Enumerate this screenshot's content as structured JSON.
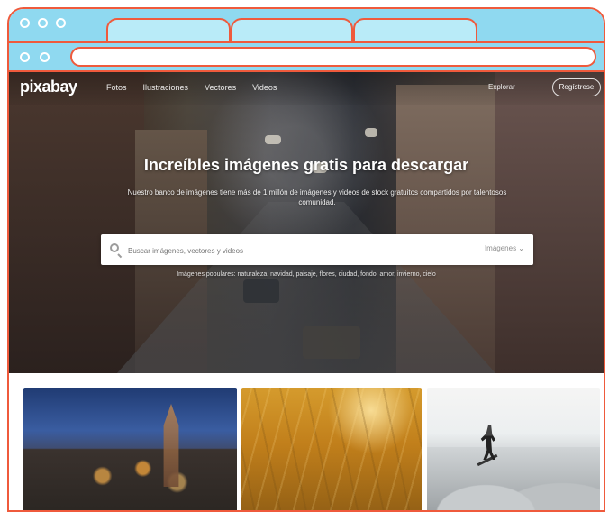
{
  "browser": {
    "address_value": "",
    "tabs": [
      {
        "label": ""
      },
      {
        "label": ""
      },
      {
        "label": ""
      }
    ]
  },
  "site": {
    "logo": "pixabay",
    "menu": [
      "Fotos",
      "Ilustraciones",
      "Vectores",
      "Videos"
    ],
    "login": "Explorar",
    "signup": "Regístrese"
  },
  "hero": {
    "title": "Increíbles imágenes gratis para descargar",
    "subtitle": "Nuestro banco de imágenes tiene más de 1 millón de imágenes y videos de stock gratuitos compartidos por talentosos comunidad.",
    "search_placeholder": "Buscar imágenes, vectores y videos",
    "search_type": "Imágenes ⌄",
    "suggestions": "Imágenes populares: naturaleza, navidad, paisaje, flores, ciudad, fondo, amor, invierno, cielo"
  }
}
